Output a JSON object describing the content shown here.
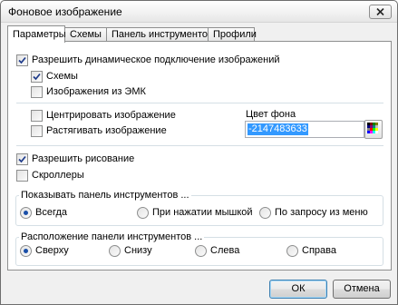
{
  "window": {
    "title": "Фоновое изображение",
    "close_icon": "close-icon"
  },
  "tabs": [
    "Параметры",
    "Схемы",
    "Панель инструментов",
    "Профили"
  ],
  "options": {
    "allow_dynamic": {
      "label": "Разрешить динамическое подключение изображений",
      "checked": true
    },
    "schemes": {
      "label": "Схемы",
      "checked": true
    },
    "emk_images": {
      "label": "Изображения из ЭМК",
      "checked": false
    },
    "center_image": {
      "label": "Центрировать изображение",
      "checked": false
    },
    "stretch_image": {
      "label": "Растягивать изображение",
      "checked": false
    },
    "bg_color_label": "Цвет фона",
    "bg_color_value": "-2147483633",
    "allow_drawing": {
      "label": "Разрешить рисование",
      "checked": true
    },
    "scrollers": {
      "label": "Скроллеры",
      "checked": false
    }
  },
  "show_toolbar": {
    "title": "Показывать панель инструментов ...",
    "options": [
      "Всегда",
      "При нажатии мышкой",
      "По запросу из меню"
    ],
    "selected": "Всегда"
  },
  "toolbar_position": {
    "title": "Расположение панели инструментов ...",
    "options": [
      "Сверху",
      "Снизу",
      "Слева",
      "Справа"
    ],
    "selected": "Сверху"
  },
  "buttons": {
    "ok": "ОК",
    "cancel": "Отмена"
  },
  "colors": {
    "accent": "#3399ff",
    "radio_dot": "#1a4fa8",
    "check": "#1d3a8a"
  }
}
